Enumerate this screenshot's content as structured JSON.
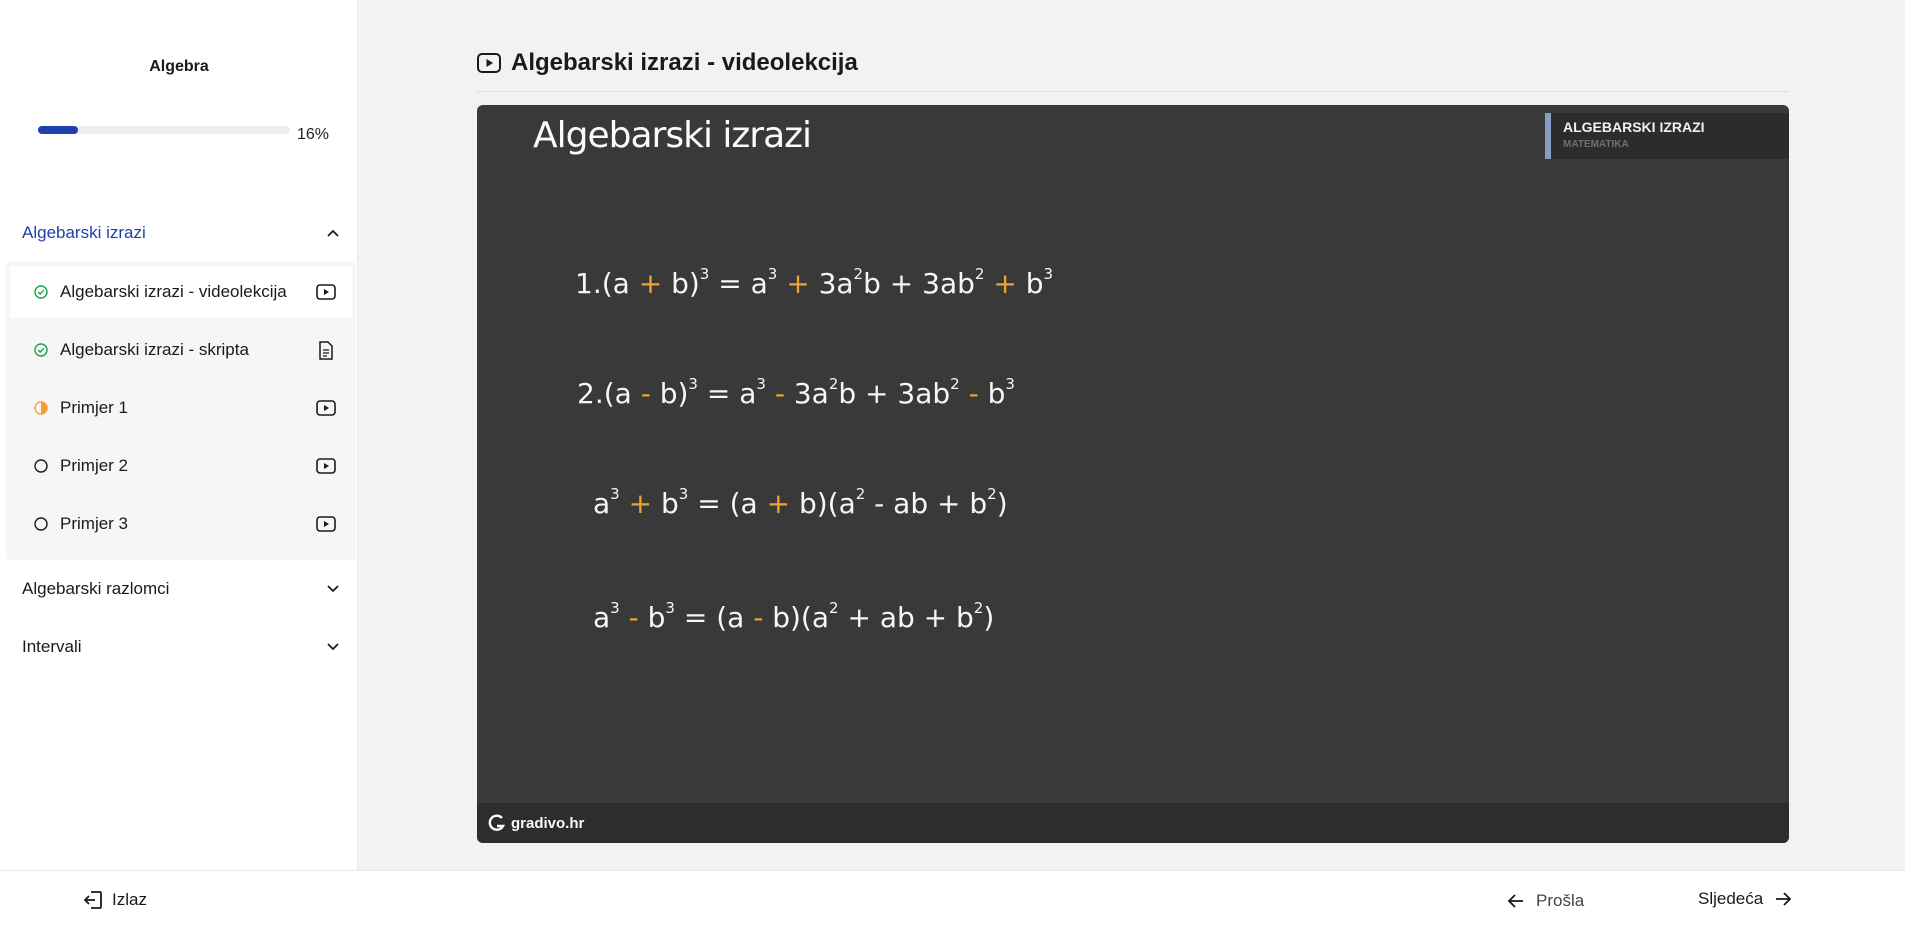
{
  "sidebar": {
    "course_title": "Algebra",
    "progress": {
      "percent": 16,
      "text": "16%"
    },
    "sections": [
      {
        "label": "Algebarski izrazi",
        "expanded": true
      },
      {
        "label": "Algebarski razlomci",
        "expanded": false
      },
      {
        "label": "Intervali",
        "expanded": false
      }
    ],
    "lessons": [
      {
        "label": "Algebarski izrazi - videolekcija",
        "status": "completed",
        "type": "video"
      },
      {
        "label": "Algebarski izrazi - skripta",
        "status": "completed",
        "type": "document"
      },
      {
        "label": "Primjer 1",
        "status": "in-progress",
        "type": "video"
      },
      {
        "label": "Primjer 2",
        "status": "not-started",
        "type": "video"
      },
      {
        "label": "Primjer 3",
        "status": "not-started",
        "type": "video"
      }
    ]
  },
  "main": {
    "title": "Algebarski izrazi - videolekcija",
    "video": {
      "board_title": "Algebarski izrazi",
      "badge_title": "ALGEBARSKI IZRAZI",
      "badge_subtitle": "MATEMATIKA",
      "brand": "gradivo.hr"
    }
  },
  "footer": {
    "exit_label": "Izlaz",
    "prev_label": "Prošla",
    "next_label": "Sljedeća"
  },
  "colors": {
    "accent": "#1e40af",
    "completed": "#16a34a",
    "in_progress": "#f0a332",
    "board": "#393939",
    "board_highlight": "#f0a332"
  }
}
